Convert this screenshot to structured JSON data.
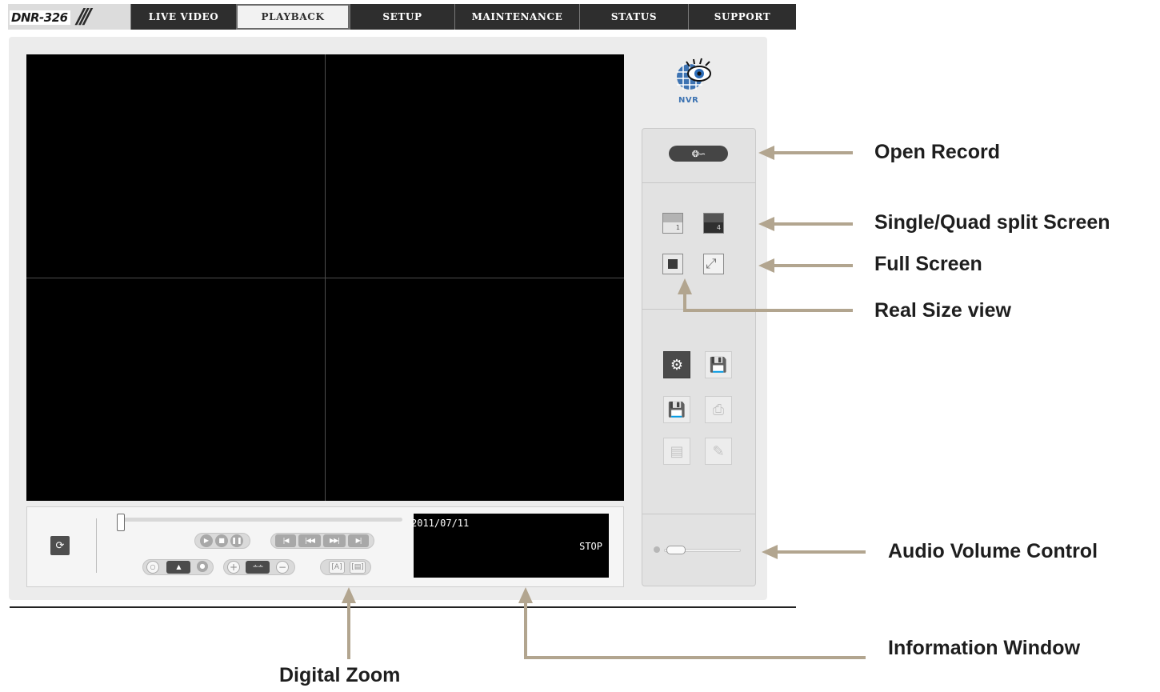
{
  "header": {
    "model": "DNR-326",
    "nav": [
      {
        "label": "LIVE VIDEO",
        "active": false
      },
      {
        "label": "PLAYBACK",
        "active": true
      },
      {
        "label": "SETUP",
        "active": false
      },
      {
        "label": "MAINTENANCE",
        "active": false
      },
      {
        "label": "STATUS",
        "active": false
      },
      {
        "label": "SUPPORT",
        "active": false
      }
    ]
  },
  "logo": {
    "text": "NVR"
  },
  "info_window": {
    "date": "2011/07/11",
    "status": "STOP"
  },
  "callouts": {
    "open_record": "Open Record",
    "split_screen": "Single/Quad split Screen",
    "full_screen": "Full Screen",
    "real_size": "Real Size view",
    "audio_volume": "Audio Volume Control",
    "information_window": "Information Window",
    "digital_zoom": "Digital Zoom"
  },
  "colors": {
    "nav_bg": "#2e2e2e",
    "annotation_arrow": "#b2a58f",
    "video_bg": "#000000",
    "logo_blue": "#3d73b2"
  }
}
